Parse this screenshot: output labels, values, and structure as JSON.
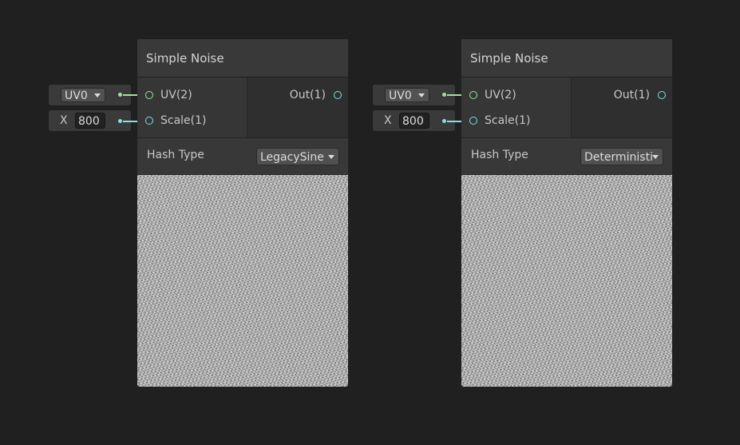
{
  "colors": {
    "background": "#202020",
    "node_body": "#2f2f2f",
    "node_title": "#393939",
    "vector2_port": "#9ce39a",
    "float_port": "#84e0e4"
  },
  "nodes": [
    {
      "title": "Simple Noise",
      "inputs": [
        {
          "label": "UV(2)",
          "type": "vector2",
          "connector": {
            "kind": "dropdown",
            "value": "UV0"
          }
        },
        {
          "label": "Scale(1)",
          "type": "float",
          "connector": {
            "kind": "number",
            "axis": "X",
            "value": "800"
          }
        }
      ],
      "output": {
        "label": "Out(1)"
      },
      "setting": {
        "label": "Hash Type",
        "value": "LegacySine"
      },
      "preview_icon": "noise-preview"
    },
    {
      "title": "Simple Noise",
      "inputs": [
        {
          "label": "UV(2)",
          "type": "vector2",
          "connector": {
            "kind": "dropdown",
            "value": "UV0"
          }
        },
        {
          "label": "Scale(1)",
          "type": "float",
          "connector": {
            "kind": "number",
            "axis": "X",
            "value": "800"
          }
        }
      ],
      "output": {
        "label": "Out(1)"
      },
      "setting": {
        "label": "Hash Type",
        "value": "Deterministi"
      },
      "preview_icon": "noise-preview"
    }
  ]
}
